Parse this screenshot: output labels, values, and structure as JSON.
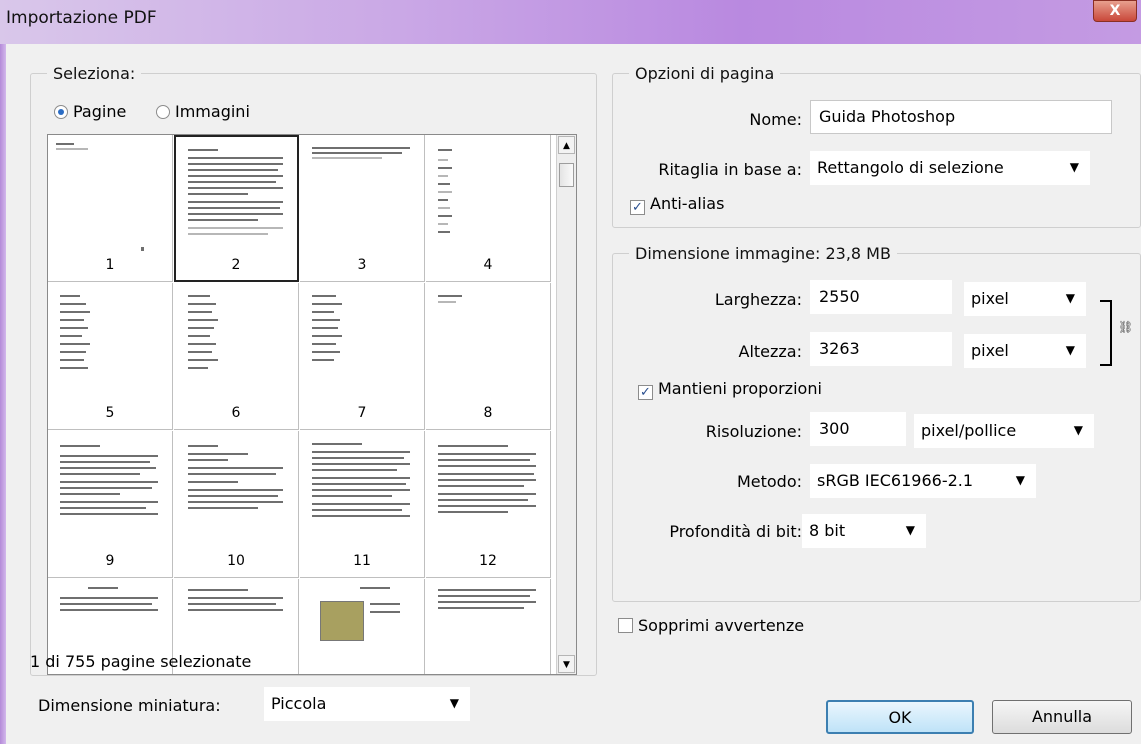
{
  "window": {
    "title": "Importazione PDF",
    "close_label": "X"
  },
  "select_group": {
    "legend": "Seleziona:",
    "radio_pages": "Pagine",
    "radio_images": "Immagini",
    "selected_radio": "Pagine",
    "thumbnails": [
      {
        "label": "1"
      },
      {
        "label": "2"
      },
      {
        "label": "3"
      },
      {
        "label": "4"
      },
      {
        "label": "5"
      },
      {
        "label": "6"
      },
      {
        "label": "7"
      },
      {
        "label": "8"
      },
      {
        "label": "9"
      },
      {
        "label": "10"
      },
      {
        "label": "11"
      },
      {
        "label": "12"
      },
      {
        "label": ""
      },
      {
        "label": ""
      },
      {
        "label": ""
      },
      {
        "label": ""
      }
    ],
    "selected_thumbnail": "2",
    "status": "1 di 755 pagine selezionate",
    "thumb_size_label": "Dimensione miniatura:",
    "thumb_size_value": "Piccola"
  },
  "page_options": {
    "legend": "Opzioni di pagina",
    "name_label": "Nome:",
    "name_value": "Guida Photoshop",
    "crop_label": "Ritaglia in base a:",
    "crop_value": "Rettangolo di selezione",
    "antialias_label": "Anti-alias",
    "antialias_checked": true
  },
  "image_size": {
    "legend": "Dimensione immagine: 23,8 MB",
    "width_label": "Larghezza:",
    "width_value": "2550",
    "width_unit": "pixel",
    "height_label": "Altezza:",
    "height_value": "3263",
    "height_unit": "pixel",
    "constrain_label": "Mantieni proporzioni",
    "constrain_checked": true,
    "resolution_label": "Risoluzione:",
    "resolution_value": "300",
    "resolution_unit": "pixel/pollice",
    "mode_label": "Metodo:",
    "mode_value": "sRGB IEC61966-2.1",
    "bitdepth_label": "Profondità di bit:",
    "bitdepth_value": "8 bit"
  },
  "suppress_warnings_label": "Sopprimi avvertenze",
  "suppress_warnings_checked": false,
  "buttons": {
    "ok": "OK",
    "cancel": "Annulla"
  },
  "colors": {
    "title_gradient_start": "#d9c7ea",
    "title_gradient_end": "#b989e0",
    "default_button_border": "#3c7fb1"
  },
  "icons": {
    "dropdown": "chevron-down-icon",
    "link": "chain-link-icon",
    "close": "close-icon"
  }
}
